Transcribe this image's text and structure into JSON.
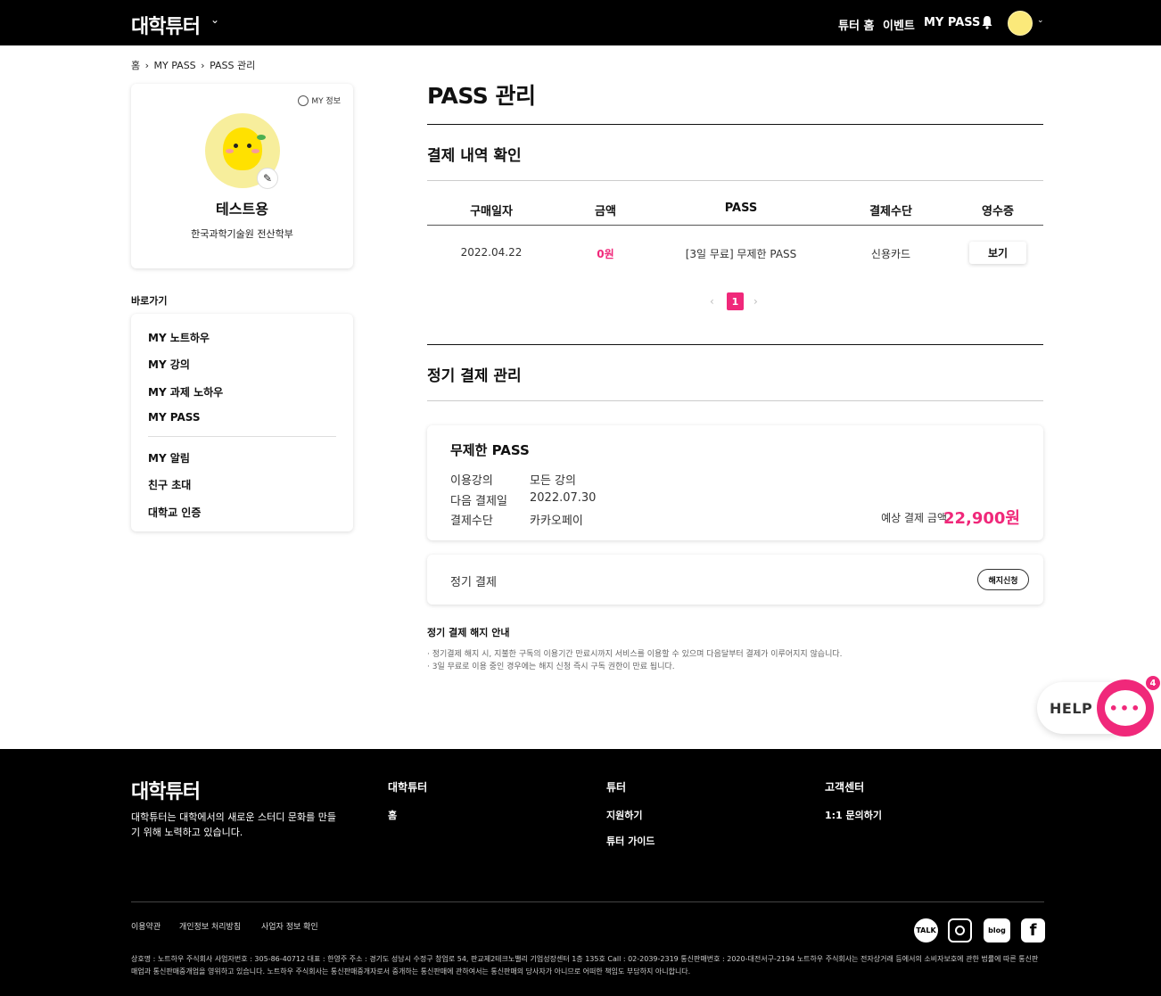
{
  "header": {
    "logo": "대학튜터",
    "nav": [
      "튜터 홈",
      "이벤트",
      "MY PASS"
    ]
  },
  "breadcrumb": [
    "홈",
    "MY PASS",
    "PASS 관리"
  ],
  "profile": {
    "my_info": "MY 정보",
    "name": "테스트용",
    "school": "한국과학기술원 전산학부"
  },
  "shortcuts": {
    "title": "바로가기",
    "items": [
      "MY 노트하우",
      "MY 강의",
      "MY 과제 노하우",
      "MY PASS",
      "MY 알림",
      "친구 초대",
      "대학교 인증"
    ]
  },
  "main": {
    "title": "PASS 관리",
    "payments": {
      "title": "결제 내역 확인",
      "headers": [
        "구매일자",
        "금액",
        "PASS",
        "결제수단",
        "영수증"
      ],
      "rows": [
        {
          "date": "2022.04.22",
          "amount": "0원",
          "pass": "[3일 무료] 무제한 PASS",
          "method": "신용카드",
          "receipt": "보기"
        }
      ],
      "page": "1"
    },
    "subscription": {
      "title": "정기 결제 관리",
      "name": "무제한 PASS",
      "rows": [
        {
          "key": "이용강의",
          "value": "모든 강의"
        },
        {
          "key": "다음 결제일",
          "value": "2022.07.30"
        },
        {
          "key": "결제수단",
          "value": "카카오페이"
        }
      ],
      "estimate_label": "예상 결제 금액",
      "estimate_value": "22,900원",
      "auto_label": "정기 결제",
      "cancel_label": "해지신청"
    },
    "notice": {
      "title": "정기 결제 해지 안내",
      "lines": [
        "· 정기결제 해지 시, 지불한 구독의 이용기간 만료시까지 서비스를 이용할 수 있으며 다음달부터 결제가 이루어지지 않습니다.",
        "· 3일 무료로 이용 중인 경우에는 해지 신청 즉시 구독 권한이 만료 됩니다."
      ]
    }
  },
  "help": {
    "label": "HELP",
    "badge": "4"
  },
  "footer": {
    "logo": "대학튜터",
    "desc": "대학튜터는 대학에서의 새로운 스터디 문화를 만들기 위해 노력하고 있습니다.",
    "cols": [
      {
        "title": "대학튜터",
        "items": [
          "홈"
        ]
      },
      {
        "title": "튜터",
        "items": [
          "지원하기",
          "튜터 가이드"
        ]
      },
      {
        "title": "고객센터",
        "items": [
          "1:1 문의하기"
        ]
      }
    ],
    "links": [
      "이용약관",
      "개인정보 처리방침",
      "사업자 정보 확인"
    ],
    "legal": "상호명 : 노트하우 주식회사 사업자번호 : 305-86-40712 대표 : 한영주 주소 : 경기도 성남시 수정구 창업로 54, 판교제2테크노밸리 기업성장센터 1층 135호 Call : 02-2039-2319 통신판매번호 : 2020-대전서구-2194 노트하우 주식회사는 전자상거래 등에서의 소비자보호에 관한 법률에 따른 통신판매업과 통신판매중개업을 영위하고 있습니다. 노트하우 주식회사는 통신판매중개자로서 중개하는 통신판매에 관하여서는 통신판매의 당사자가 아니므로 어떠한 책임도 부담하지 아니합니다.",
    "sns": [
      "TALK",
      "instagram-icon",
      "blog",
      "facebook-icon"
    ]
  },
  "colors": {
    "accent": "#f0287a",
    "topbar": "#000000"
  }
}
